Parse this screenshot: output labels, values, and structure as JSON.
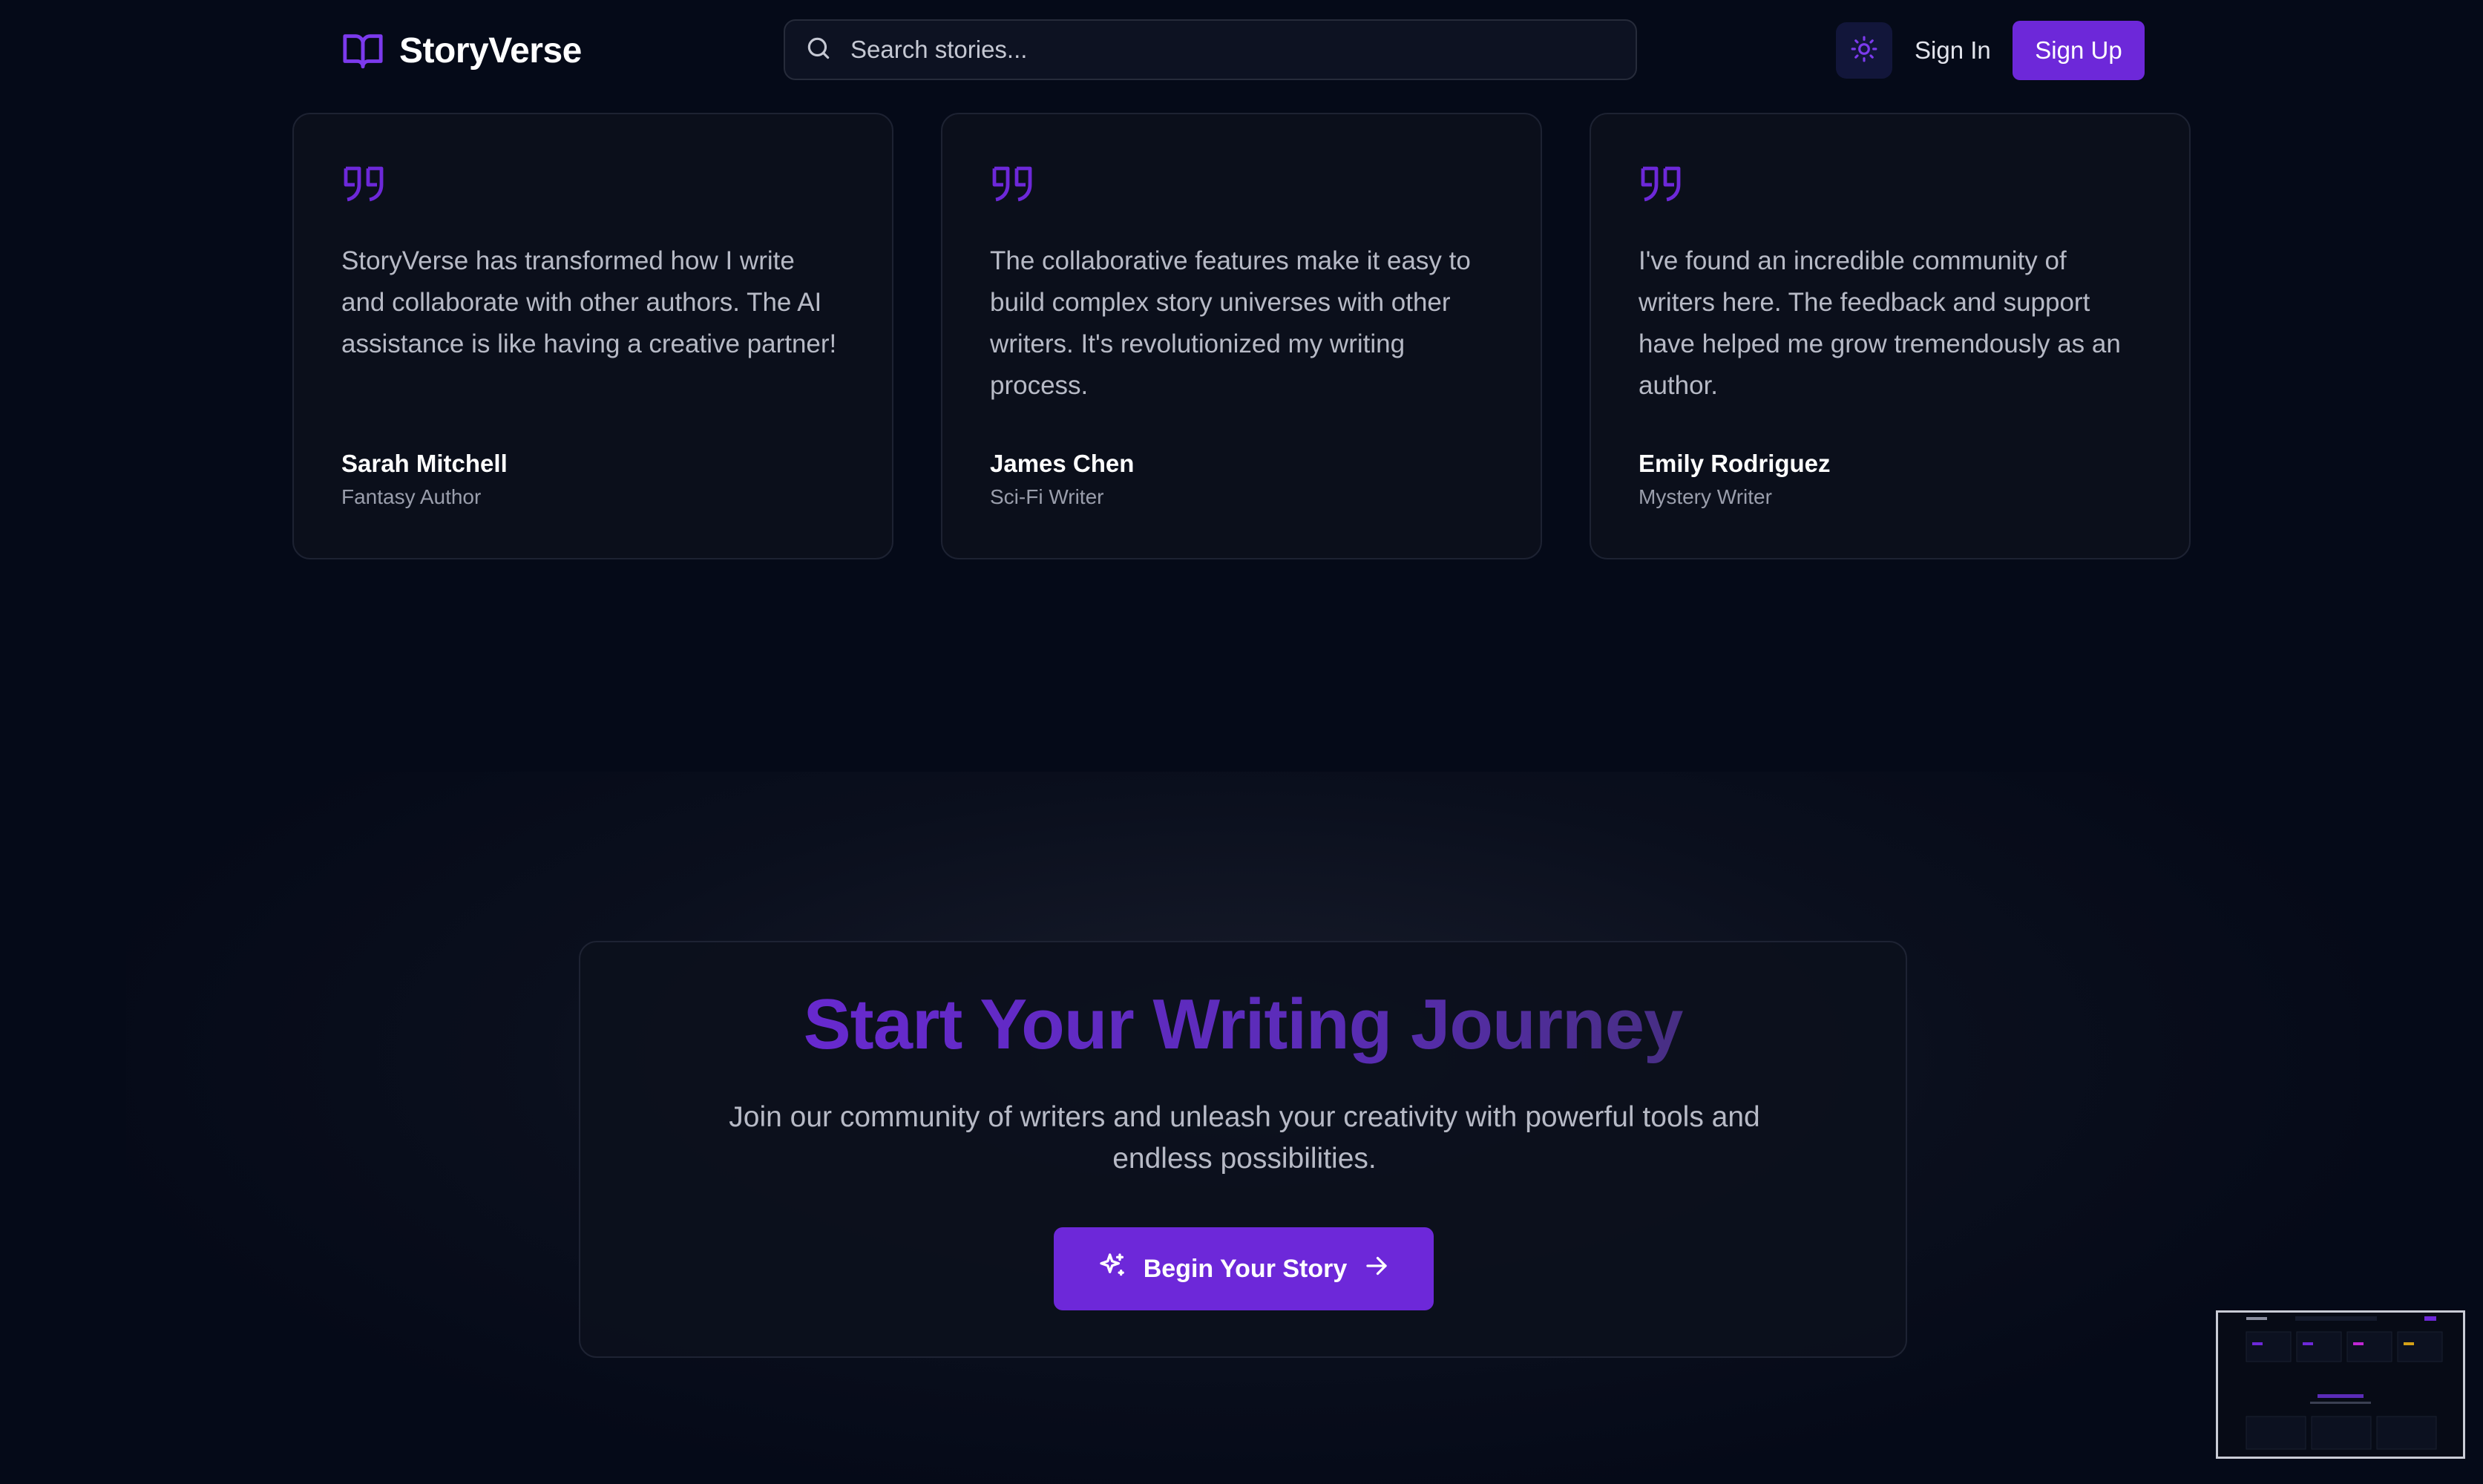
{
  "header": {
    "brand_name": "StoryVerse",
    "brand_icon": "book-open-icon",
    "search_placeholder": "Search stories...",
    "theme_toggle_icon": "sun-icon",
    "signin_label": "Sign In",
    "signup_label": "Sign Up"
  },
  "testimonials": [
    {
      "quote": "StoryVerse has transformed how I write and collaborate with other authors. The AI assistance is like having a creative partner!",
      "name": "Sarah Mitchell",
      "role": "Fantasy Author"
    },
    {
      "quote": "The collaborative features make it easy to build complex story universes with other writers. It's revolutionized my writing process.",
      "name": "James Chen",
      "role": "Sci-Fi Writer"
    },
    {
      "quote": "I've found an incredible community of writers here. The feedback and support have helped me grow tremendously as an author.",
      "name": "Emily Rodriguez",
      "role": "Mystery Writer"
    }
  ],
  "cta": {
    "title": "Start Your Writing Journey",
    "subtitle": "Join our community of writers and unleash your creativity with powerful tools and endless possibilities.",
    "button_label": "Begin Your Story",
    "button_icon": "sparkles-icon",
    "button_trailing_icon": "arrow-right-icon"
  },
  "colors": {
    "background": "#050a18",
    "accent": "#6d28d9",
    "card_background": "#0b0f1b",
    "card_border": "#1d2232",
    "muted_text": "#b7bac6"
  }
}
